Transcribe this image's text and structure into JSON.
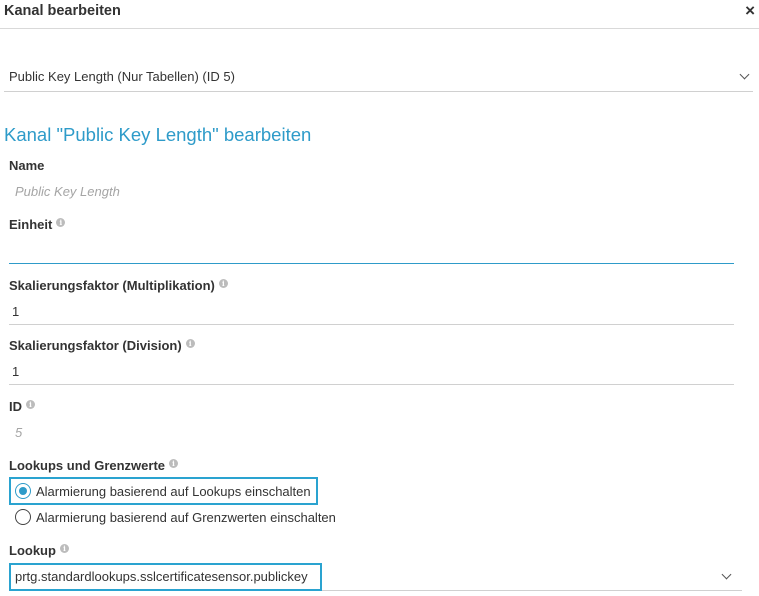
{
  "dialog": {
    "title": "Kanal bearbeiten",
    "close_label": "×"
  },
  "channel_select": {
    "value": "Public Key Length (Nur Tabellen) (ID 5)"
  },
  "section": {
    "title": "Kanal \"Public Key Length\" bearbeiten"
  },
  "fields": {
    "name": {
      "label": "Name",
      "value": "Public Key Length"
    },
    "unit": {
      "label": "Einheit",
      "value": ""
    },
    "scale_mult": {
      "label": "Skalierungsfaktor (Multiplikation)",
      "value": "1"
    },
    "scale_div": {
      "label": "Skalierungsfaktor (Division)",
      "value": "1"
    },
    "id": {
      "label": "ID",
      "value": "5"
    }
  },
  "lookups": {
    "label": "Lookups und Grenzwerte",
    "options": [
      {
        "label": "Alarmierung basierend auf Lookups einschalten",
        "checked": true
      },
      {
        "label": "Alarmierung basierend auf Grenzwerten einschalten",
        "checked": false
      }
    ]
  },
  "lookup": {
    "label": "Lookup",
    "value": "prtg.standardlookups.sslcertificatesensor.publickey"
  },
  "icons": {
    "info": "info-icon",
    "close": "close-icon",
    "dropdown": "chevron-down-icon"
  },
  "colors": {
    "accent": "#2e9bc9",
    "highlight": "#2aa3d0"
  }
}
